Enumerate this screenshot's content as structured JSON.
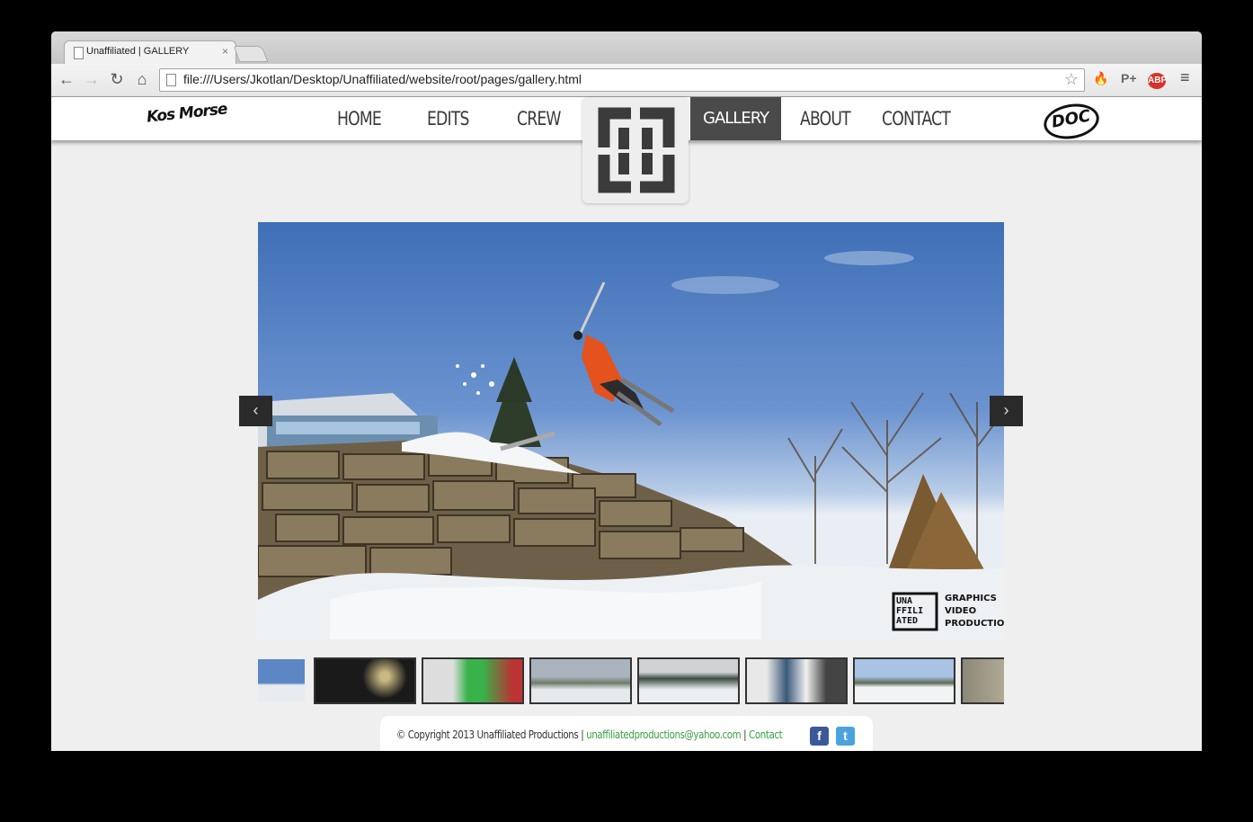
{
  "browser": {
    "tab_title": "Unaffiliated | GALLERY",
    "tab_close": "×",
    "url": "file:///Users/Jkotlan/Desktop/Unaffiliated/website/root/pages/gallery.html",
    "back": "←",
    "forward": "→",
    "reload": "↻",
    "home": "⌂",
    "star": "☆",
    "extensions": [
      {
        "label": "🔥",
        "color": "#e8731c"
      },
      {
        "label": "P+",
        "color": "#666666"
      },
      {
        "label": "ABP",
        "color": "#d8322b"
      },
      {
        "label": "≡",
        "color": "#444444"
      }
    ]
  },
  "nav": {
    "left_logo": "Kos Morse",
    "items": [
      {
        "label": "HOME"
      },
      {
        "label": "EDITS"
      },
      {
        "label": "CREW"
      },
      {
        "label": "GALLERY",
        "active": true
      },
      {
        "label": "ABOUT"
      },
      {
        "label": "CONTACT"
      }
    ],
    "right_logo": "DOC"
  },
  "slideshow": {
    "prev": "‹",
    "next": "›",
    "watermark": {
      "logo": "UNA FFILI ATED",
      "lines": [
        "GRAPHICS",
        "VIDEO",
        "PRODUCTION"
      ]
    }
  },
  "thumbnails": [
    {
      "name": "thumb-1"
    },
    {
      "name": "thumb-2"
    },
    {
      "name": "thumb-3"
    },
    {
      "name": "thumb-4"
    },
    {
      "name": "thumb-5"
    },
    {
      "name": "thumb-6"
    },
    {
      "name": "thumb-7"
    },
    {
      "name": "thumb-8"
    }
  ],
  "footer": {
    "copyright": "© Copyright 2013 Unaffiliated Productions",
    "sep1": " | ",
    "email": "unaffiliatedproductions@yahoo.com",
    "sep2": " | ",
    "contact": "Contact",
    "facebook": "f",
    "twitter": "t"
  },
  "colors": {
    "nav_active_bg": "#4a4a4a",
    "link_green": "#3aa142",
    "facebook_blue": "#3b5998",
    "twitter_blue": "#4aa3df"
  }
}
